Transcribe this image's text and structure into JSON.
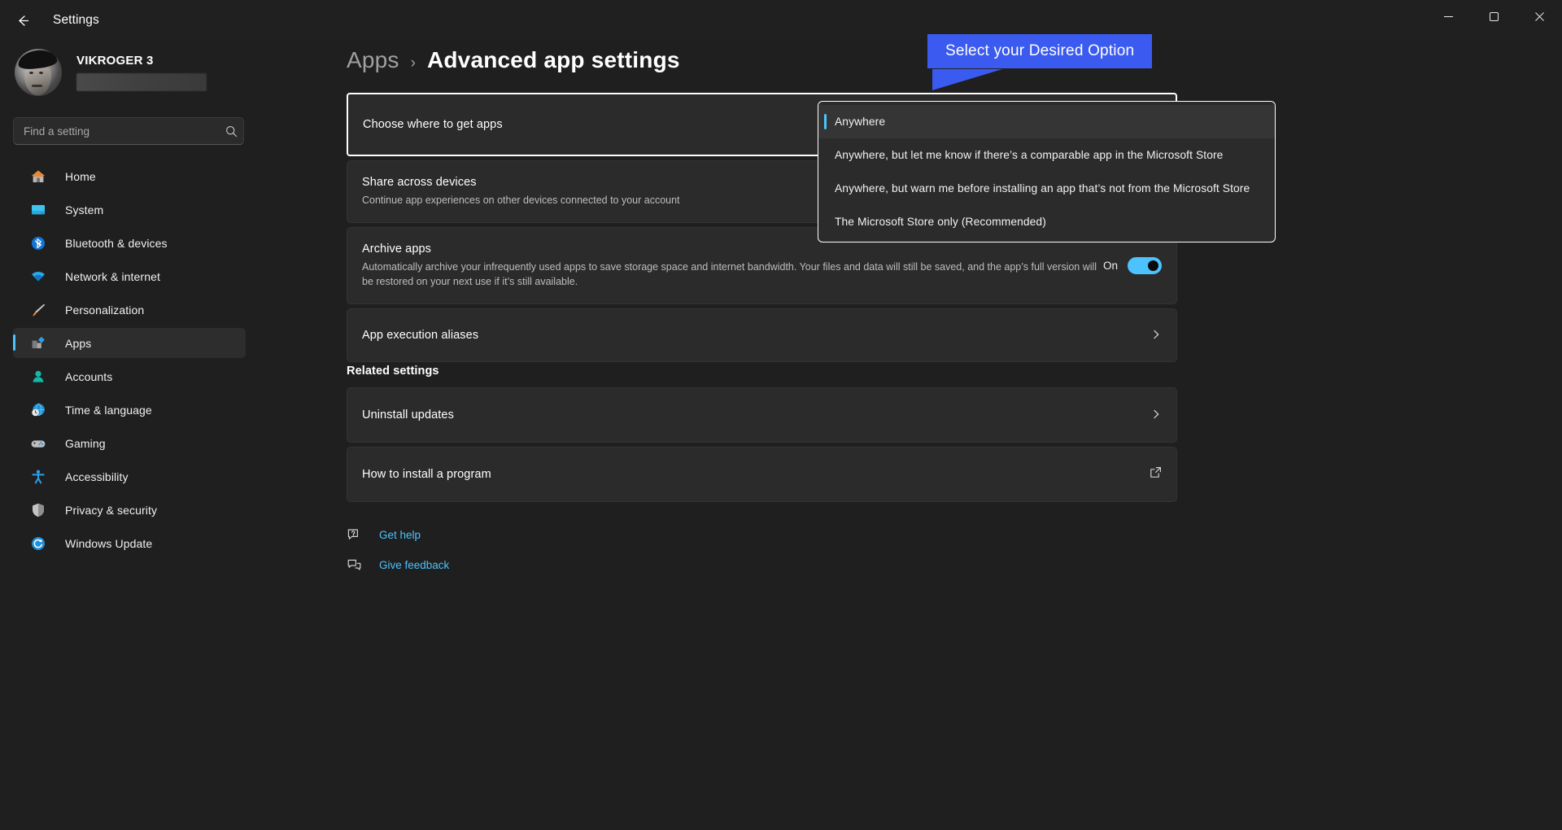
{
  "window": {
    "title": "Settings",
    "back_icon": "back-arrow-icon",
    "minimize_icon": "minimize-icon",
    "maximize_icon": "maximize-icon",
    "close_icon": "close-icon"
  },
  "profile": {
    "name": "VIKROGER 3",
    "email_redacted": true,
    "avatar_icon": "user-avatar"
  },
  "search": {
    "placeholder": "Find a setting",
    "value": "",
    "icon": "search-icon"
  },
  "sidebar": {
    "items": [
      {
        "label": "Home",
        "icon": "home-icon",
        "active": false
      },
      {
        "label": "System",
        "icon": "system-monitor-icon",
        "active": false
      },
      {
        "label": "Bluetooth & devices",
        "icon": "bluetooth-icon",
        "active": false
      },
      {
        "label": "Network & internet",
        "icon": "wifi-icon",
        "active": false
      },
      {
        "label": "Personalization",
        "icon": "paintbrush-icon",
        "active": false
      },
      {
        "label": "Apps",
        "icon": "apps-icon",
        "active": true
      },
      {
        "label": "Accounts",
        "icon": "account-person-icon",
        "active": false
      },
      {
        "label": "Time & language",
        "icon": "clock-globe-icon",
        "active": false
      },
      {
        "label": "Gaming",
        "icon": "gamepad-icon",
        "active": false
      },
      {
        "label": "Accessibility",
        "icon": "accessibility-person-icon",
        "active": false
      },
      {
        "label": "Privacy & security",
        "icon": "shield-icon",
        "active": false
      },
      {
        "label": "Windows Update",
        "icon": "update-refresh-icon",
        "active": false
      }
    ]
  },
  "breadcrumb": {
    "parent": "Apps",
    "separator": "›",
    "current": "Advanced app settings"
  },
  "main": {
    "cards": [
      {
        "title": "Choose where to get apps",
        "subtitle": "",
        "control": "dropdown",
        "focused": true
      },
      {
        "title": "Share across devices",
        "subtitle": "Continue app experiences on other devices connected to your account",
        "control": "none",
        "focused": false
      },
      {
        "title": "Archive apps",
        "subtitle": "Automatically archive your infrequently used apps to save storage space and internet bandwidth. Your files and data will still be saved, and the app’s full version will be restored on your next use if it’s still available.",
        "control": "toggle",
        "toggle_label": "On",
        "toggle_on": true,
        "focused": false
      },
      {
        "title": "App execution aliases",
        "subtitle": "",
        "control": "chevron",
        "focused": false
      }
    ],
    "related_heading": "Related settings",
    "related_cards": [
      {
        "title": "Uninstall updates",
        "control": "chevron"
      },
      {
        "title": "How to install a program",
        "control": "external-link"
      }
    ],
    "footer_links": [
      {
        "label": "Get help",
        "icon": "help-question-icon"
      },
      {
        "label": "Give feedback",
        "icon": "feedback-icon"
      }
    ]
  },
  "dropdown": {
    "options": [
      {
        "label": "Anywhere",
        "selected": true
      },
      {
        "label": "Anywhere, but let me know if there’s a comparable app in the Microsoft Store",
        "selected": false
      },
      {
        "label": "Anywhere, but warn me before installing an app that’s not from the Microsoft Store",
        "selected": false
      },
      {
        "label": "The Microsoft Store only (Recommended)",
        "selected": false
      }
    ]
  },
  "callout": {
    "text": "Select your Desired Option",
    "color": "#3b5bf0"
  },
  "colors": {
    "accent": "#4cc2ff",
    "window_bg": "#1f1f1f",
    "card_bg": "#2b2b2b",
    "callout_blue": "#3b5bf0"
  }
}
